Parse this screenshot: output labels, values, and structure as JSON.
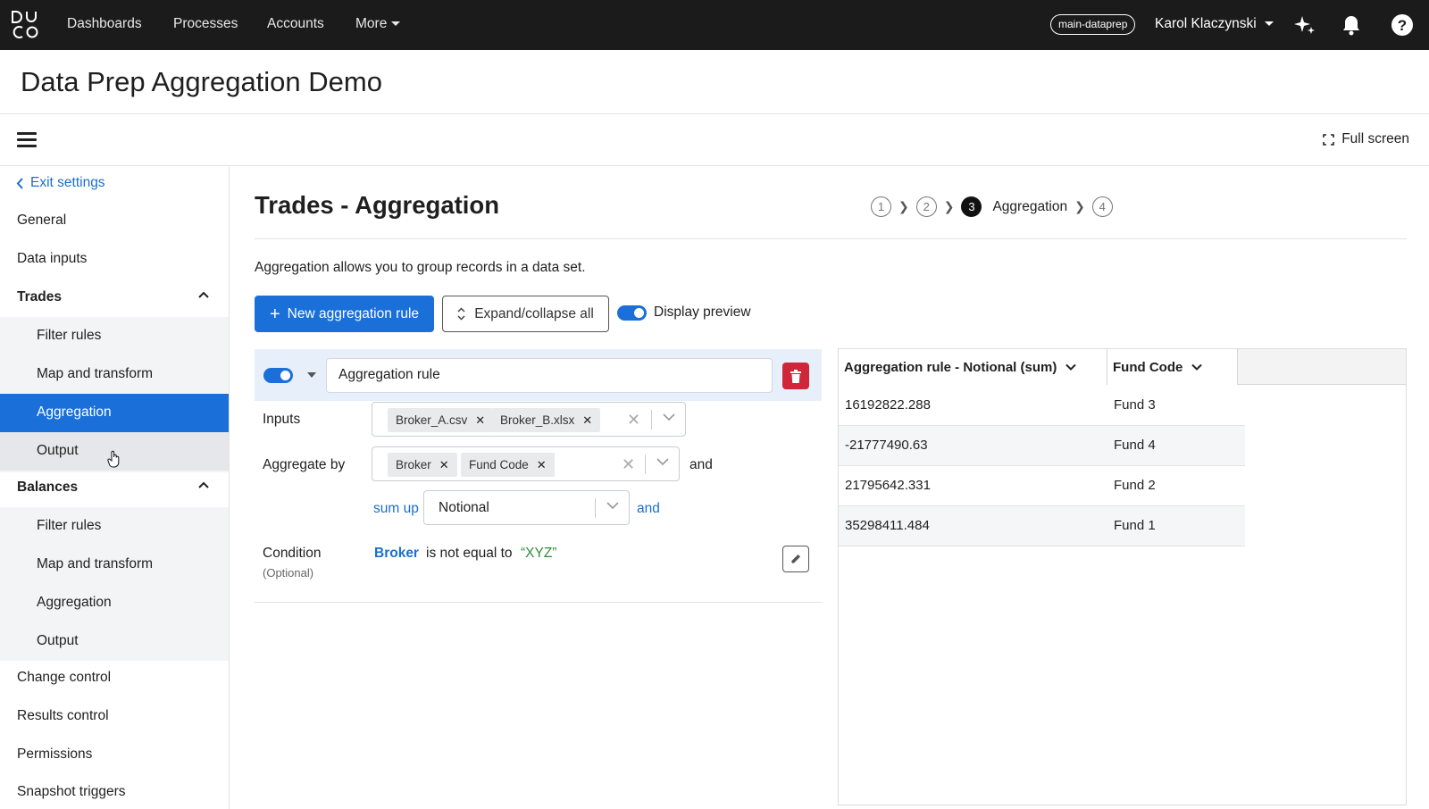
{
  "topnav": {
    "logo_text": "DUCO",
    "items": [
      "Dashboards",
      "Processes",
      "Accounts",
      "More"
    ],
    "environment": "main-dataprep",
    "user": "Karol Klaczynski",
    "icons": [
      "sparkle-icon",
      "bell-icon",
      "help-icon"
    ]
  },
  "page": {
    "title": "Data Prep Aggregation Demo"
  },
  "toolbar": {
    "fullscreen_label": "Full screen"
  },
  "sidebar": {
    "exit_label": "Exit settings",
    "items_top": [
      "General",
      "Data inputs"
    ],
    "trades": {
      "label": "Trades",
      "children": [
        "Filter rules",
        "Map and transform",
        "Aggregation",
        "Output"
      ],
      "active": "Aggregation"
    },
    "balances": {
      "label": "Balances",
      "children": [
        "Filter rules",
        "Map and transform",
        "Aggregation",
        "Output"
      ]
    },
    "items_bottom": [
      "Change control",
      "Results control",
      "Permissions",
      "Snapshot triggers"
    ]
  },
  "main": {
    "title": "Trades - Aggregation",
    "stepper": {
      "steps": [
        "1",
        "2",
        "3",
        "4"
      ],
      "active_label": "Aggregation"
    },
    "description": "Aggregation allows you to group records in a data set.",
    "new_rule_label": "New aggregation rule",
    "expand_label": "Expand/collapse all",
    "preview_label": "Display preview"
  },
  "rule": {
    "name": "Aggregation rule",
    "inputs_label": "Inputs",
    "inputs": [
      "Broker_A.csv",
      "Broker_B.xlsx"
    ],
    "aggregate_by_label": "Aggregate by",
    "aggregate_by": [
      "Broker",
      "Fund Code"
    ],
    "and_label": "and",
    "sum_up_label": "sum up",
    "sum_field": "Notional",
    "condition_label": "Condition",
    "optional_label": "(Optional)",
    "condition_field": "Broker",
    "condition_op": "is not equal to",
    "condition_value": "“XYZ”"
  },
  "preview": {
    "columns": [
      "Aggregation rule - Notional (sum)",
      "Fund Code"
    ],
    "rows": [
      [
        "16192822.288",
        "Fund 3"
      ],
      [
        "-21777490.63",
        "Fund 4"
      ],
      [
        "21795642.331",
        "Fund 2"
      ],
      [
        "35298411.484",
        "Fund 1"
      ]
    ]
  },
  "colors": {
    "accent": "#1a6fd8",
    "topbar": "#1b1b1b",
    "danger": "#d0263a",
    "value_green": "#2e8b3a"
  }
}
